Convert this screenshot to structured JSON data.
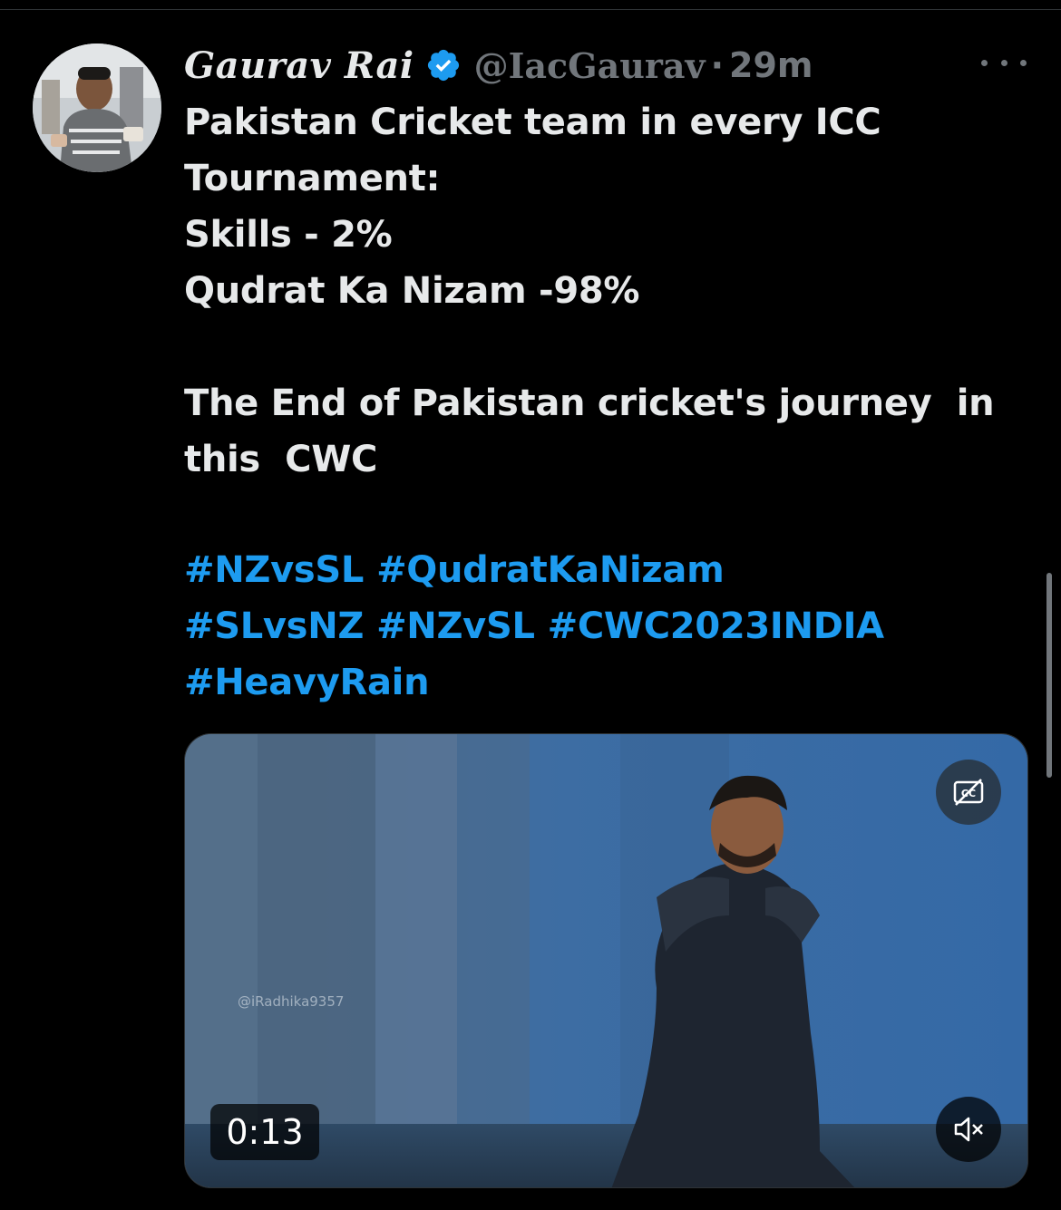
{
  "tweet": {
    "author": {
      "display_name": "Gaurav Rai",
      "handle": "@IacGaurav",
      "separator": "·",
      "time": "29m",
      "verified": true
    },
    "text_lines": [
      "Pakistan Cricket team in every ICC",
      "Tournament:",
      "Skills - 2%",
      "Qudrat Ka Nizam -98%",
      "",
      "The End of Pakistan cricket's journey  in",
      "this  CWC"
    ],
    "hashtag_rows": [
      [
        "#NZvsSL",
        "#QudratKaNizam"
      ],
      [
        "#SLvsNZ",
        "#NZvSL",
        "#CWC2023INDIA"
      ],
      [
        "#HeavyRain"
      ]
    ]
  },
  "media": {
    "type": "video",
    "duration": "0:13",
    "watermark": "@iRadhika9357",
    "captions_icon": "closed-captions-off-icon",
    "volume_icon": "volume-muted-icon"
  },
  "colors": {
    "background": "#000000",
    "text": "#e7e9ea",
    "muted": "#71767b",
    "link": "#1d9bf0",
    "verified_badge": "#1d9bf0"
  }
}
